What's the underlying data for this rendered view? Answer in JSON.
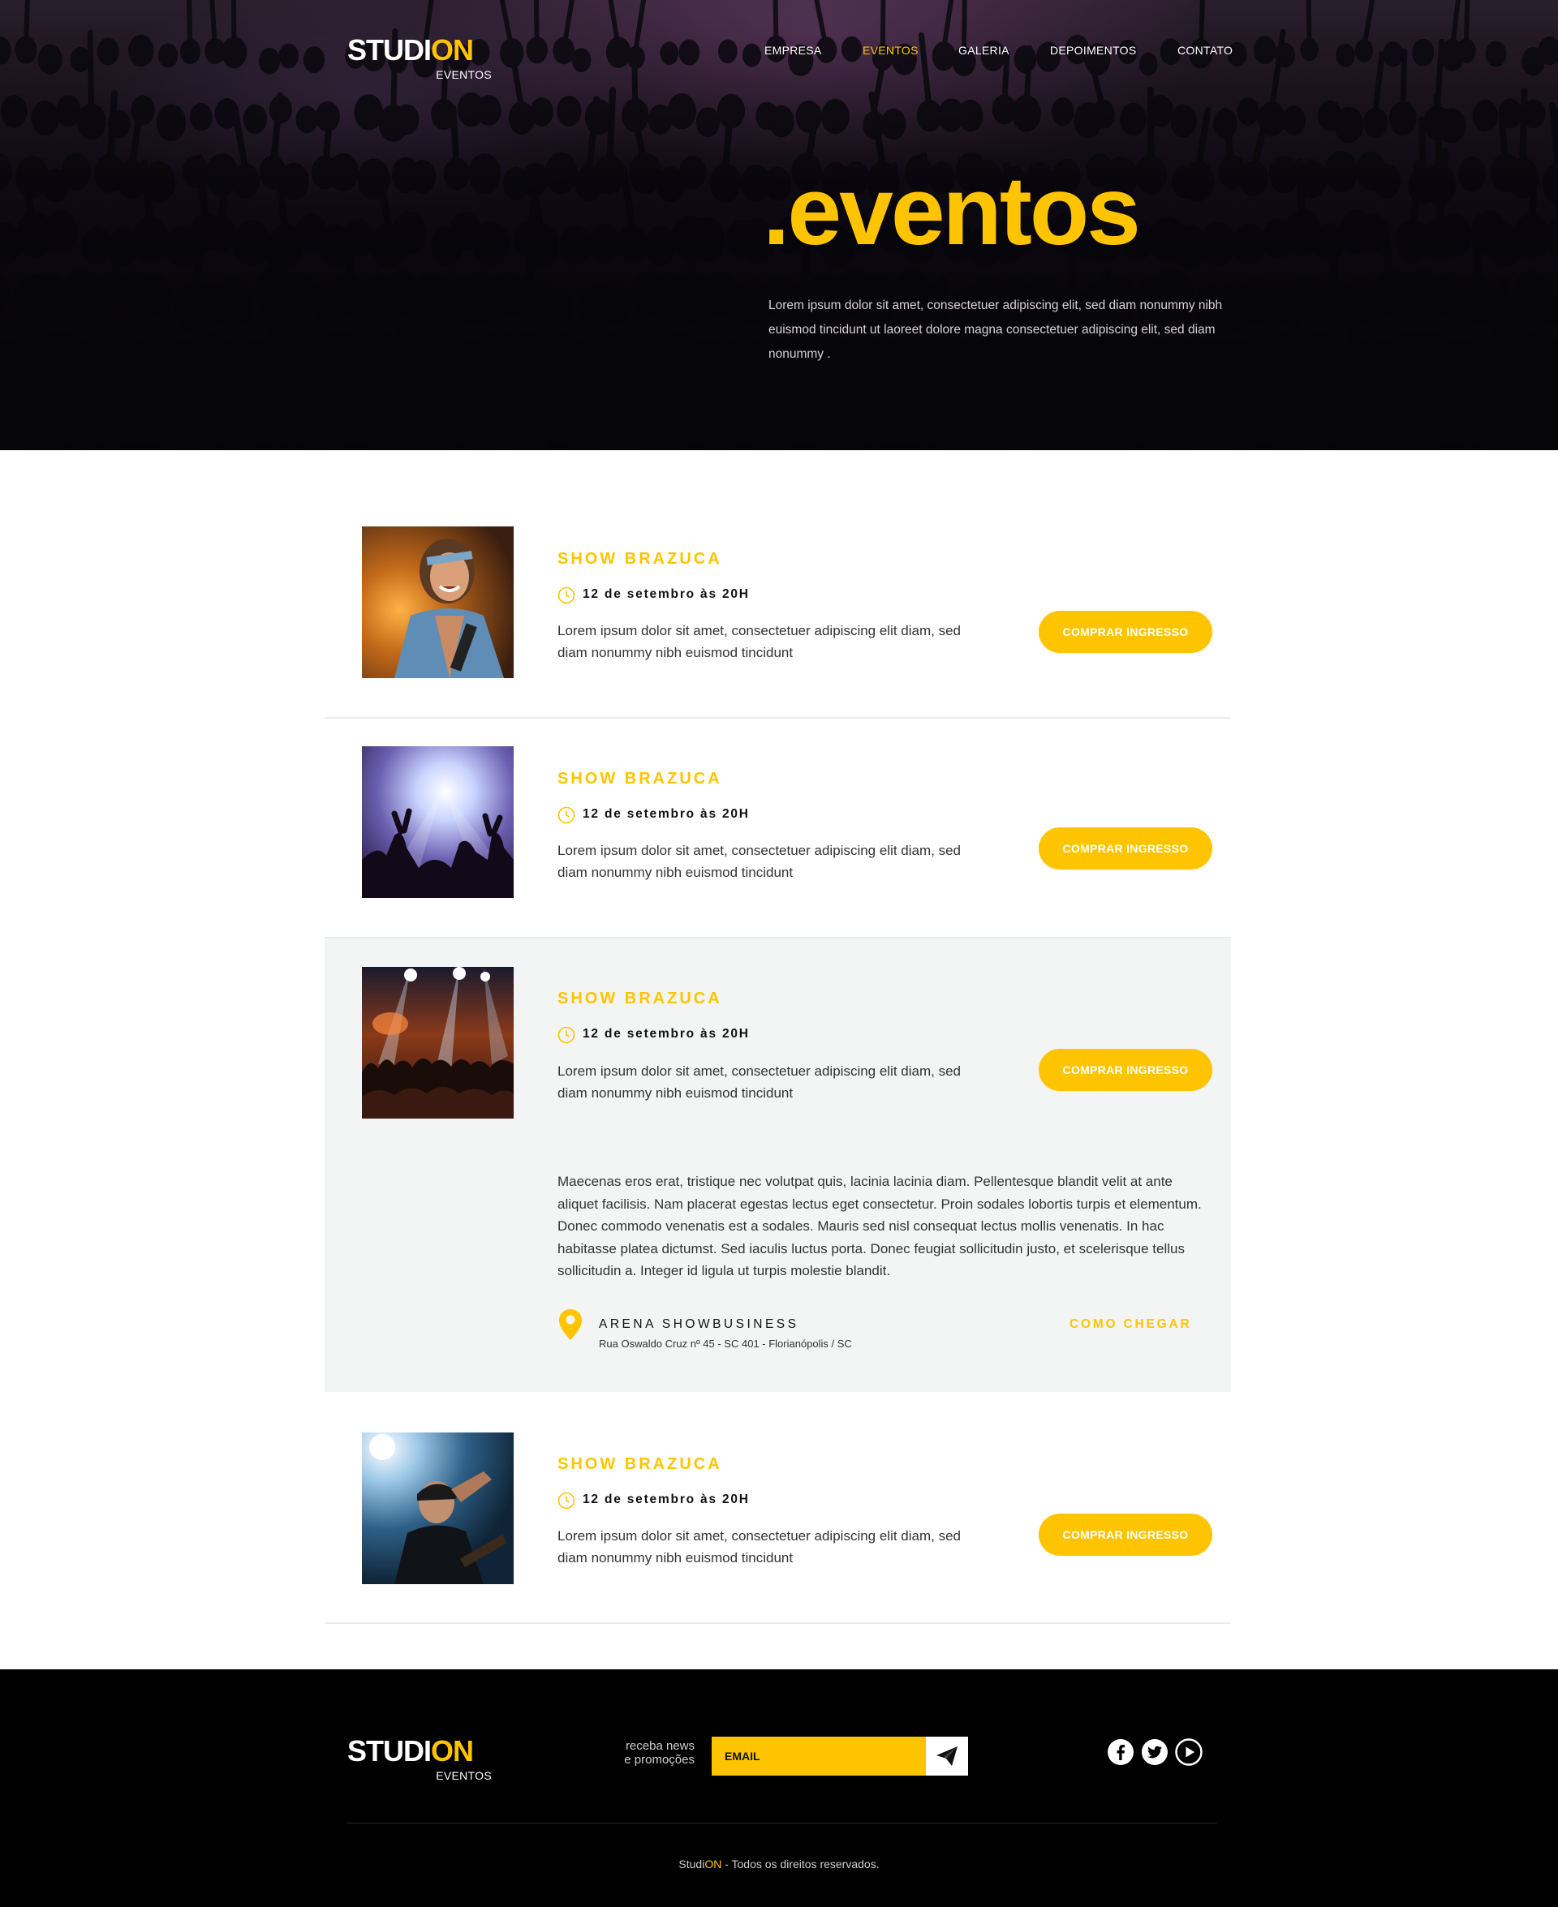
{
  "brand": {
    "name_part1": "STUDI",
    "name_part2": "ON",
    "tagline": "EVENTOS",
    "accent_color": "#ffc400"
  },
  "nav": {
    "items": [
      {
        "label": "EMPRESA"
      },
      {
        "label": "EVENTOS",
        "active": true
      },
      {
        "label": "GALERIA"
      },
      {
        "label": "DEPOIMENTOS"
      },
      {
        "label": "CONTATO"
      }
    ]
  },
  "hero": {
    "title": ".eventos",
    "text": "Lorem ipsum dolor sit amet, consectetuer adipiscing elit, sed diam nonummy nibh euismod tincidunt ut laoreet dolore magna consectetuer adipiscing elit, sed diam nonummy ."
  },
  "events": [
    {
      "title": "SHOW BRAZUCA",
      "date": "12 de setembro às 20H",
      "description": "Lorem ipsum dolor sit amet, consectetuer adipiscing elit diam, sed diam nonummy nibh euismod tincidunt",
      "button": "COMPRAR INGRESSO",
      "photo_icon": "singer-photo"
    },
    {
      "title": "SHOW BRAZUCA",
      "date": "12 de setembro às 20H",
      "description": "Lorem ipsum dolor sit amet, consectetuer adipiscing elit diam, sed diam nonummy nibh euismod tincidunt",
      "button": "COMPRAR INGRESSO",
      "photo_icon": "stage-lights-photo"
    },
    {
      "title": "SHOW BRAZUCA",
      "date": "12 de setembro às 20H",
      "description": "Lorem ipsum dolor sit amet, consectetuer adipiscing elit diam, sed diam nonummy nibh euismod tincidunt",
      "button": "COMPRAR INGRESSO",
      "photo_icon": "concert-crowd-photo",
      "details": {
        "text": "Maecenas eros erat, tristique nec volutpat quis, lacinia lacinia diam. Pellentesque blandit velit at ante aliquet facilisis. Nam placerat egestas lectus eget consectetur. Proin sodales lobortis turpis et elementum. Donec commodo venenatis est a sodales. Mauris sed nisl consequat lectus mollis venenatis. In hac habitasse platea dictumst. Sed iaculis luctus porta. Donec feugiat sollicitudin justo, et scelerisque tellus sollicitudin a. Integer id ligula ut turpis molestie blandit.",
        "venue_name": "ARENA SHOWBUSINESS",
        "venue_address": "Rua Oswaldo Cruz nº 45 - SC 401 - Florianópolis / SC",
        "directions_label": "COMO CHEGAR"
      }
    },
    {
      "title": "SHOW BRAZUCA",
      "date": "12 de setembro às 20H",
      "description": "Lorem ipsum dolor sit amet, consectetuer adipiscing elit diam, sed diam nonummy nibh euismod tincidunt",
      "button": "COMPRAR INGRESSO",
      "photo_icon": "guitarist-photo"
    }
  ],
  "footer": {
    "newsletter_line1": "receba news",
    "newsletter_line2": "e promoções",
    "email_placeholder": "EMAIL",
    "social_icons": [
      "facebook-icon",
      "twitter-icon",
      "youtube-icon"
    ],
    "copyright_part1": "Studi",
    "copyright_part2": "ON",
    "copyright_part3": " - Todos os direitos reservados."
  }
}
